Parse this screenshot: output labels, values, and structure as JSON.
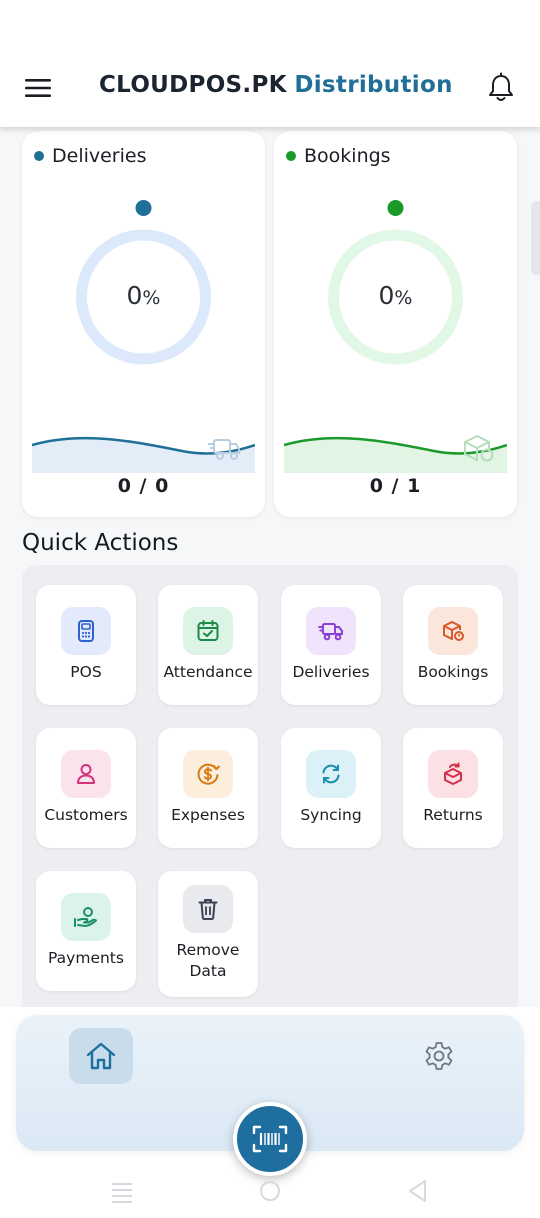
{
  "header": {
    "brand": "CLOUDPOS.PK",
    "subtitle": "Distribution",
    "menu_icon": "hamburger-icon",
    "bell_icon": "bell-icon"
  },
  "stats": [
    {
      "label": "Deliveries",
      "percent_value": "0",
      "percent_unit": "%",
      "count": "0 / 0",
      "color": "#1f6f97",
      "ring_color": "#dce9fb",
      "progress": 0
    },
    {
      "label": "Bookings",
      "percent_value": "0",
      "percent_unit": "%",
      "count": "0 / 1",
      "color": "#1a9a2a",
      "ring_color": "#e2f8e6",
      "progress": 0
    }
  ],
  "quick_actions": {
    "title": "Quick Actions",
    "items": [
      {
        "label": "POS",
        "icon": "pos-terminal-icon",
        "bg": "#e2eafb",
        "fg": "#2f5fd0"
      },
      {
        "label": "Attendance",
        "icon": "calendar-check-icon",
        "bg": "#ddf3e6",
        "fg": "#1a8a4a"
      },
      {
        "label": "Deliveries",
        "icon": "delivery-truck-icon",
        "bg": "#efe4fb",
        "fg": "#8a3fd6"
      },
      {
        "label": "Bookings",
        "icon": "box-icon",
        "bg": "#fbe6dc",
        "fg": "#d8582a"
      },
      {
        "label": "Customers",
        "icon": "user-icon",
        "bg": "#fbe3ee",
        "fg": "#d4317a"
      },
      {
        "label": "Expenses",
        "icon": "dollar-coin-icon",
        "bg": "#fbeedc",
        "fg": "#d97a12"
      },
      {
        "label": "Syncing",
        "icon": "sync-icon",
        "bg": "#dcf1f7",
        "fg": "#1a8fb0"
      },
      {
        "label": "Returns",
        "icon": "return-box-icon",
        "bg": "#fbe1e4",
        "fg": "#d42e48"
      },
      {
        "label": "Payments",
        "icon": "hand-coin-icon",
        "bg": "#dcf3ea",
        "fg": "#1a9066"
      },
      {
        "label": "Remove\nData",
        "label_line1": "Remove",
        "label_line2": "Data",
        "icon": "trash-icon",
        "bg": "#e8eaee",
        "fg": "#3b4350"
      }
    ]
  },
  "bottom_nav": {
    "home_icon": "home-icon",
    "settings_icon": "gear-icon",
    "scan_icon": "barcode-scan-icon",
    "accent": "#1e6fa0"
  }
}
